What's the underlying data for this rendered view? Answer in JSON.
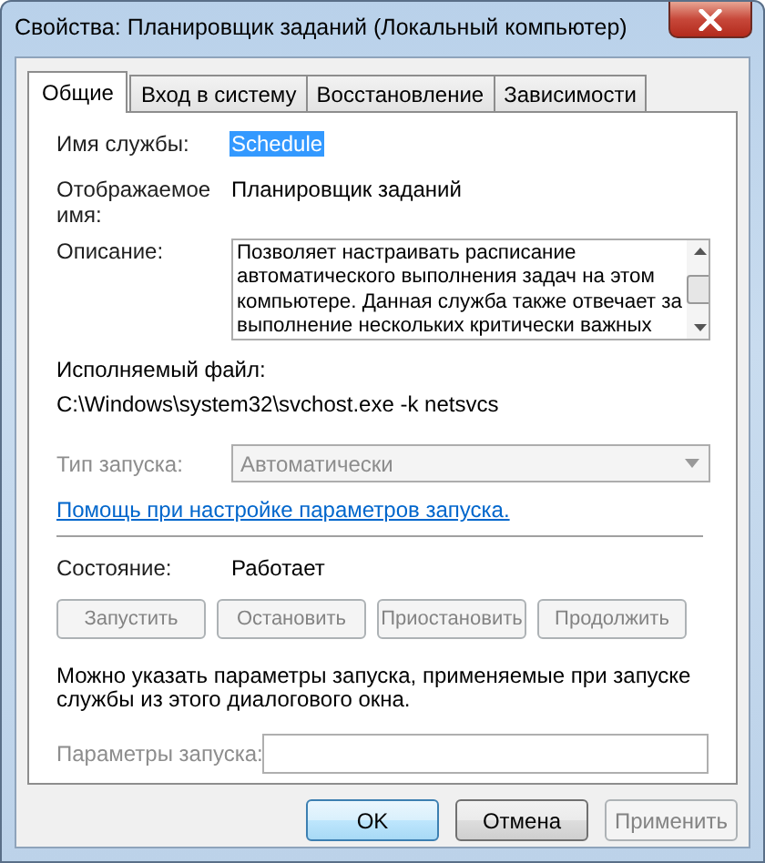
{
  "window": {
    "title": "Свойства: Планировщик заданий (Локальный компьютер)"
  },
  "tabs": [
    {
      "label": "Общие",
      "selected": true
    },
    {
      "label": "Вход в систему",
      "selected": false
    },
    {
      "label": "Восстановление",
      "selected": false
    },
    {
      "label": "Зависимости",
      "selected": false
    }
  ],
  "service_name": {
    "label": "Имя службы:",
    "value": "Schedule",
    "selected": true
  },
  "display_name": {
    "label": "Отображаемое имя:",
    "value": "Планировщик заданий"
  },
  "description": {
    "label": "Описание:",
    "lines": [
      "Позволяет настраивать расписание",
      "автоматического выполнения задач на этом",
      "компьютере. Данная служба также отвечает за",
      "выполнение нескольких критически важных"
    ]
  },
  "executable": {
    "label": "Исполняемый файл:",
    "value": "C:\\Windows\\system32\\svchost.exe -k netsvcs"
  },
  "startup_type": {
    "label": "Тип запуска:",
    "value": "Автоматически",
    "disabled": true
  },
  "help_link": "Помощь при настройке параметров запуска.",
  "status": {
    "label": "Состояние:",
    "value": "Работает"
  },
  "service_buttons": [
    {
      "label": "Запустить",
      "disabled": true
    },
    {
      "label": "Остановить",
      "disabled": true
    },
    {
      "label": "Приостановить",
      "disabled": true
    },
    {
      "label": "Продолжить",
      "disabled": true
    }
  ],
  "hint": "Можно указать параметры запуска, применяемые при запуске службы из этого диалогового окна.",
  "start_params": {
    "label": "Параметры запуска:",
    "disabled": true
  },
  "dialog_buttons": [
    {
      "label": "OK",
      "default": true,
      "disabled": false
    },
    {
      "label": "Отмена",
      "default": false,
      "disabled": false
    },
    {
      "label": "Применить",
      "default": false,
      "disabled": true
    }
  ]
}
